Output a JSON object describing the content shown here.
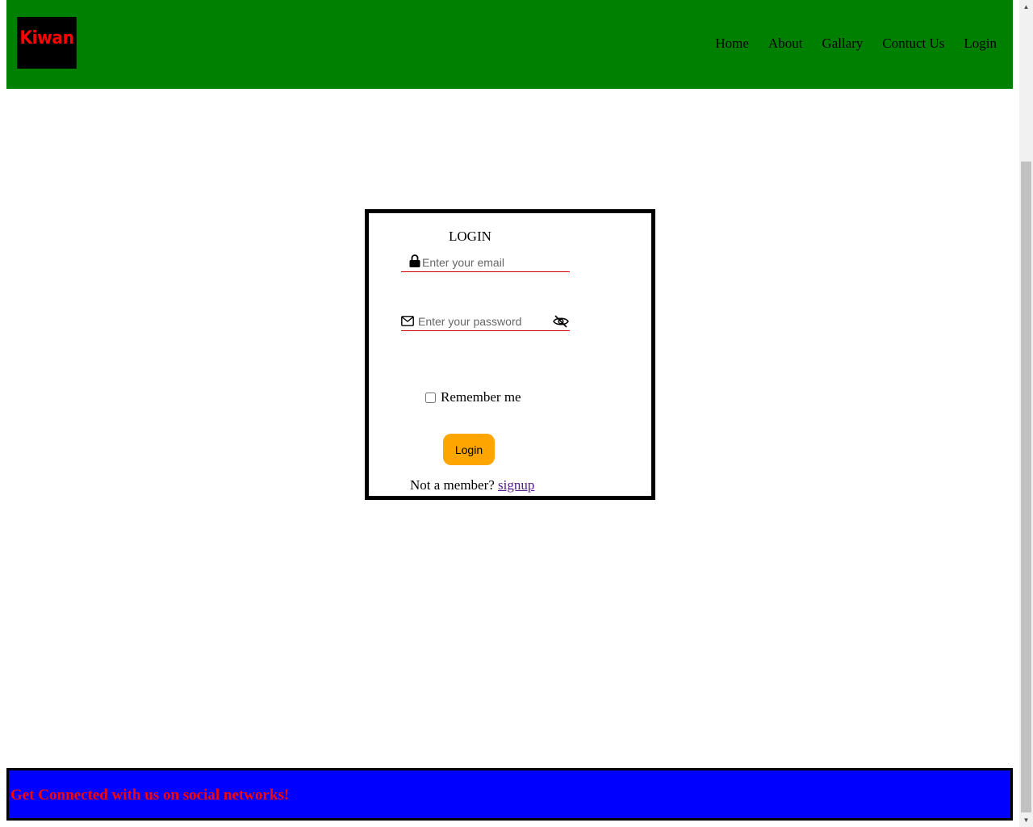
{
  "header": {
    "logo_text": "Kiwan",
    "nav": [
      "Home",
      "About",
      "Gallary",
      "Contuct Us",
      "Login"
    ]
  },
  "login": {
    "title": "LOGIN",
    "email_placeholder": "Enter your email",
    "password_placeholder": "Enter your password",
    "remember_label": "Remember me",
    "login_button": "Login",
    "not_member": "Not a member?",
    "signup_link": "signup"
  },
  "footer": {
    "text": "Get Connected with us on social networks!"
  },
  "icons": {
    "email_field_icon": "lock-icon",
    "password_field_icon": "envelope-icon",
    "password_toggle_icon": "eye-slash-icon"
  },
  "colors": {
    "header_bg": "#008000",
    "logo_bg": "#000000",
    "logo_text": "#ff0000",
    "field_underline": "#d00000",
    "login_button_bg": "#ffa500",
    "footer_bg": "#0000ff",
    "footer_text": "#ff0000"
  }
}
